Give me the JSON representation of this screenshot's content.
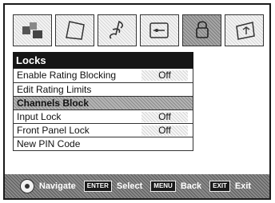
{
  "menu_icons": [
    "picture-icon",
    "audio-icon",
    "music-icon",
    "setup-icon",
    "locks-icon",
    "applications-icon"
  ],
  "panel": {
    "title": "Locks",
    "items": [
      {
        "label": "Enable Rating Blocking",
        "value": "Off"
      },
      {
        "label": "Edit Rating Limits",
        "value": ""
      },
      {
        "label": "Channels Block",
        "value": ""
      },
      {
        "label": "Input Lock",
        "value": "Off"
      },
      {
        "label": "Front Panel Lock",
        "value": "Off"
      },
      {
        "label": "New PIN Code",
        "value": ""
      }
    ]
  },
  "bottom_bar": {
    "navigate": "Navigate",
    "enter_key": "ENTER",
    "select": "Select",
    "menu_key": "MENU",
    "back": "Back",
    "exit_key": "EXIT",
    "exit": "Exit"
  },
  "colors": {
    "title_bg": "#151515",
    "selected_bg": "#9a9a9a",
    "frame": "#1a1a1a"
  }
}
